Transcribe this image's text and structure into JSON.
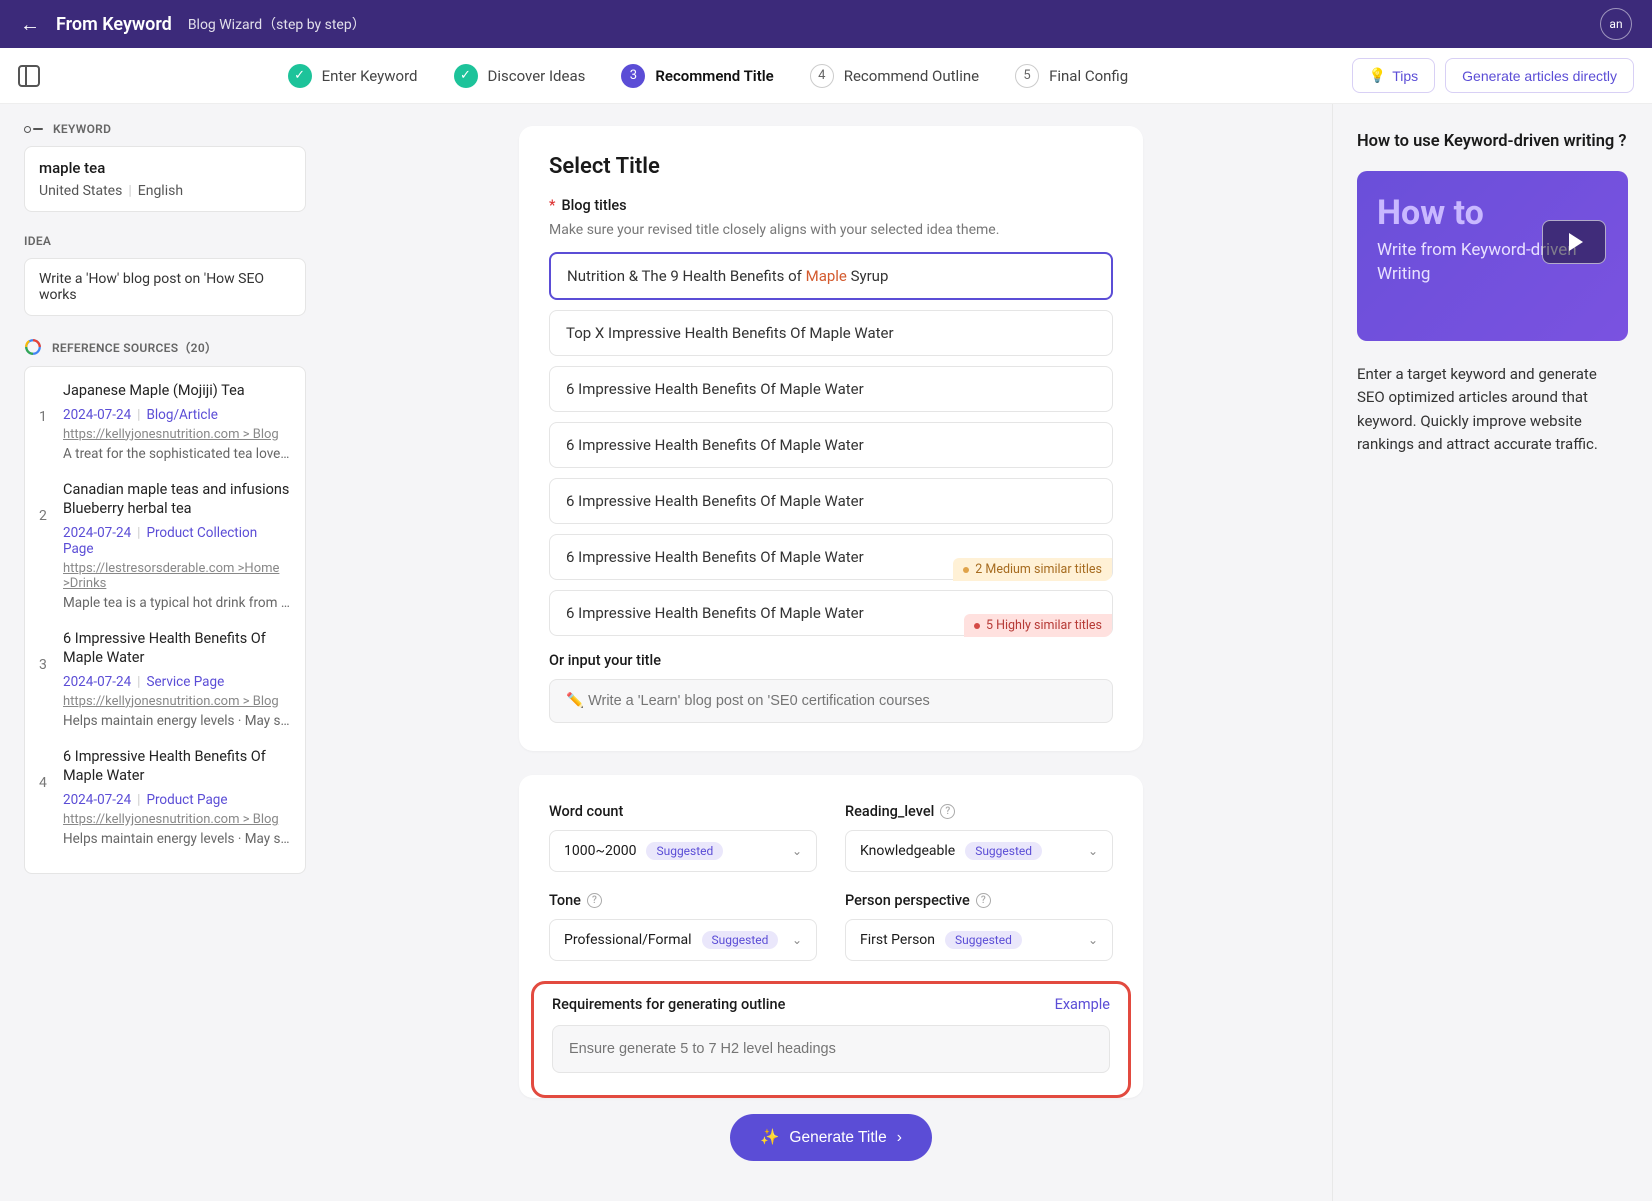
{
  "header": {
    "title": "From Keyword",
    "subtitle": "Blog Wizard（step by step）",
    "avatar": "an"
  },
  "steps": {
    "items": [
      {
        "label": "Enter Keyword",
        "state": "done"
      },
      {
        "label": "Discover Ideas",
        "state": "done"
      },
      {
        "num": "3",
        "label": "Recommend Title",
        "state": "active"
      },
      {
        "num": "4",
        "label": "Recommend Outline",
        "state": "pending"
      },
      {
        "num": "5",
        "label": "Final Config",
        "state": "pending"
      }
    ],
    "tips": "Tips",
    "generate_direct": "Generate articles directly"
  },
  "sidebar": {
    "keyword_label": "KEYWORD",
    "keyword": "maple tea",
    "country": "United States",
    "language": "English",
    "idea_label": "IDEA",
    "idea": "Write a 'How' blog post on 'How SEO works",
    "ref_label": "REFERENCE SOURCES（20）",
    "refs": [
      {
        "n": "1",
        "title": "Japanese Maple (Mojiji) Tea",
        "date": "2024-07-24",
        "type": "Blog/Article",
        "url": "https://kellyjonesnutrition.com > Blog",
        "desc": "A treat for the sophisticated tea lover. Ma…"
      },
      {
        "n": "2",
        "title": "Canadian maple teas and infusions Blueberry herbal tea",
        "date": "2024-07-24",
        "type": "Product Collection Page",
        "url": "https://lestresorsderable.com >Home >Drinks",
        "desc": "Maple tea is a typical hot drink from Cana…"
      },
      {
        "n": "3",
        "title": "6 Impressive Health Benefits Of Maple Water",
        "date": "2024-07-24",
        "type": "Service Page",
        "url": "https://kellyjonesnutrition.com > Blog",
        "desc": "Helps maintain energy levels · May suppo…"
      },
      {
        "n": "4",
        "title": "6 Impressive Health Benefits Of Maple Water",
        "date": "2024-07-24",
        "type": "Product Page",
        "url": "https://kellyjonesnutrition.com > Blog",
        "desc": "Helps maintain energy levels · May suppo…"
      }
    ]
  },
  "main": {
    "select_title": "Select Title",
    "blog_titles_label": "Blog titles",
    "blog_titles_help": "Make sure your revised title closely aligns with your selected idea theme.",
    "titles": [
      {
        "pre": "Nutrition & The 9 Health Benefits of ",
        "hl": "Maple",
        "post": " Syrup",
        "selected": true
      },
      {
        "text": "Top X Impressive Health Benefits Of Maple Water"
      },
      {
        "text": "6 Impressive Health Benefits Of Maple Water"
      },
      {
        "text": "6 Impressive Health Benefits Of Maple Water"
      },
      {
        "text": "6 Impressive Health Benefits Of Maple Water"
      },
      {
        "text": "6 Impressive Health Benefits Of Maple Water",
        "badge": "medium",
        "badge_text": "2 Medium similar titles"
      },
      {
        "text": "6 Impressive Health Benefits Of Maple Water",
        "badge": "high",
        "badge_text": "5 Highly similar titles"
      }
    ],
    "or_input": "Or input your title",
    "custom_placeholder": "✏️ Write a 'Learn' blog post on 'SE0 certification courses"
  },
  "settings": {
    "word_count_label": "Word count",
    "word_count_value": "1000~2000",
    "reading_label": "Reading_level",
    "reading_value": "Knowledgeable",
    "tone_label": "Tone",
    "tone_value": "Professional/Formal",
    "person_label": "Person perspective",
    "person_value": "First Person",
    "suggested": "Suggested",
    "req_label": "Requirements for generating outline",
    "example": "Example",
    "req_placeholder": "Ensure generate 5 to 7 H2 level headings",
    "generate": "Generate Title"
  },
  "right": {
    "title": "How to use Keyword-driven writing ?",
    "howto": "How to",
    "sub": "Write from Keyword-driven Writing",
    "desc": "Enter a target keyword and generate SEO optimized articles around that keyword. Quickly improve website rankings and attract accurate traffic."
  }
}
